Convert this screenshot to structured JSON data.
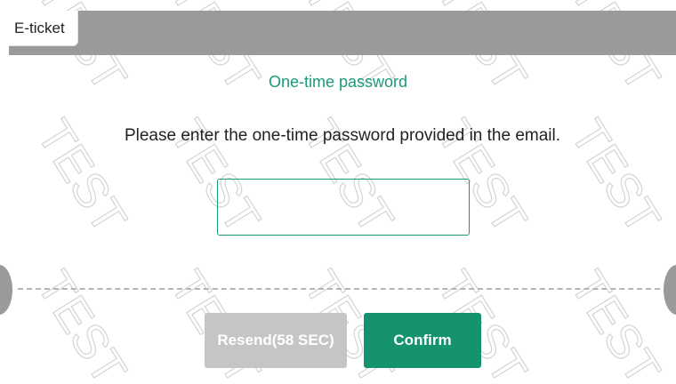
{
  "header": {
    "tab_label": "E-ticket"
  },
  "main": {
    "title": "One-time password",
    "instruction": "Please enter the one-time password provided in the email.",
    "otp_value": ""
  },
  "actions": {
    "resend_label": "Resend(58 SEC)",
    "confirm_label": "Confirm"
  },
  "watermark": {
    "text": "TEST"
  },
  "colors": {
    "accent": "#1a9a78",
    "confirm_bg": "#14936e",
    "disabled_bg": "#c5c5c5",
    "header_bg": "#9a9a9a"
  }
}
